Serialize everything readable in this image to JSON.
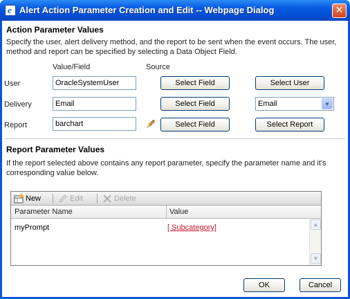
{
  "window": {
    "title": "Alert Action Parameter Creation and Edit -- Webpage Dialog",
    "close_glyph": "✕"
  },
  "action_section": {
    "title": "Action Parameter Values",
    "description": "Specify the user, alert delivery method, and the report to be sent when the event occurs. The user, method and report can be specified by selecting a Data Object Field.",
    "col_value": "Value/Field",
    "col_source": "Source",
    "rows": [
      {
        "label": "User",
        "value": "OracleSystemUser",
        "field_button": "Select Field",
        "source_button": "Select User"
      },
      {
        "label": "Delivery",
        "value": "Email",
        "field_button": "Select Field",
        "source_select": "Email"
      },
      {
        "label": "Report",
        "value": "barchart",
        "field_button": "Select Field",
        "source_button": "Select Report"
      }
    ]
  },
  "report_section": {
    "title": "Report Parameter Values",
    "description": "If the report selected above contains any report parameter, specify the parameter name and it's corresponding value below.",
    "toolbar": {
      "new": "New",
      "edit": "Edit",
      "delete": "Delete"
    },
    "columns": [
      "Parameter Name",
      "Value"
    ],
    "rows": [
      {
        "name": "myPrompt",
        "value": "[ Subcategory]"
      }
    ]
  },
  "footer": {
    "ok": "OK",
    "cancel": "Cancel"
  },
  "colors": {
    "title_bar": "#0b5de4",
    "link": "#c8102e",
    "button_border": "#003c74"
  },
  "icons": [
    "ie-page-icon",
    "pencil-icon",
    "new-grid-icon",
    "edit-pencil-icon",
    "delete-x-icon",
    "dropdown-arrow-icon",
    "scroll-up-icon",
    "scroll-down-icon"
  ]
}
